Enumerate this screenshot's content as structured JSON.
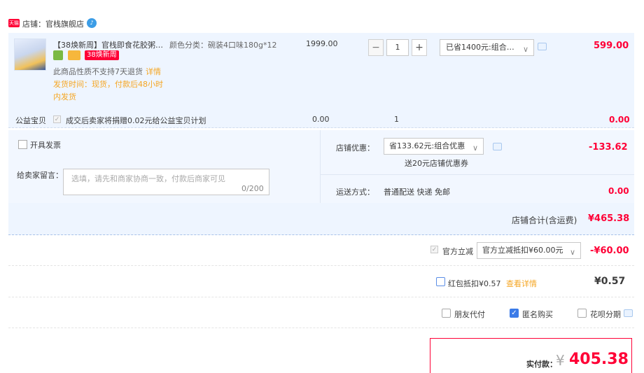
{
  "shop": {
    "logo_text": "天猫",
    "name": "店铺：官栈旗舰店"
  },
  "item": {
    "title": "【38焕新周】官栈即食花胶粥…",
    "promo_tag": "38焕新周",
    "sku": "颜色分类：碗装4口味180g*12",
    "return_note": "此商品性质不支持7天退货",
    "return_link": "详情",
    "ship_time": "发货时间：现货，付款后48小时内发货",
    "unit_price": "1999.00",
    "quantity": "1",
    "discount_option": "已省1400元:组合…",
    "total": "599.00"
  },
  "charity": {
    "label": "公益宝贝",
    "text": "成交后卖家将捐赠0.02元给公益宝贝计划",
    "price": "0.00",
    "qty": "1",
    "total": "0.00"
  },
  "options": {
    "invoice_label": "开具发票",
    "message_label": "给卖家留言：",
    "message_placeholder": "选填，请先和商家协商一致，付款后商家可见",
    "message_count": "0/200",
    "shop_coupon_label": "店铺优惠：",
    "shop_coupon_option": "省133.62元:组合优惠",
    "shop_coupon_gift": "送20元店铺优惠券",
    "shop_coupon_amount": "-133.62",
    "shipping_label": "运送方式：",
    "shipping_value": "普通配送 快递 免邮",
    "shipping_fee": "0.00"
  },
  "subtotal": {
    "label": "店铺合计(含运费)",
    "value": "¥465.38"
  },
  "official": {
    "label": "官方立减",
    "option": "官方立减抵扣¥60.00元",
    "amount": "-¥60.00"
  },
  "redpacket": {
    "label": "红包抵扣¥0.57",
    "link": "查看详情",
    "amount": "¥0.57"
  },
  "extra_options": {
    "friend_pay": "朋友代付",
    "anonymous": "匿名购买",
    "huabei": "花呗分期"
  },
  "payment": {
    "label": "实付款：",
    "currency": "¥",
    "value": "405.38"
  },
  "colors": {
    "accent": "#ff0036",
    "link_orange": "#f5a623",
    "row_bg": "#eef5ff",
    "checkbox_blue": "#3b7be8"
  }
}
